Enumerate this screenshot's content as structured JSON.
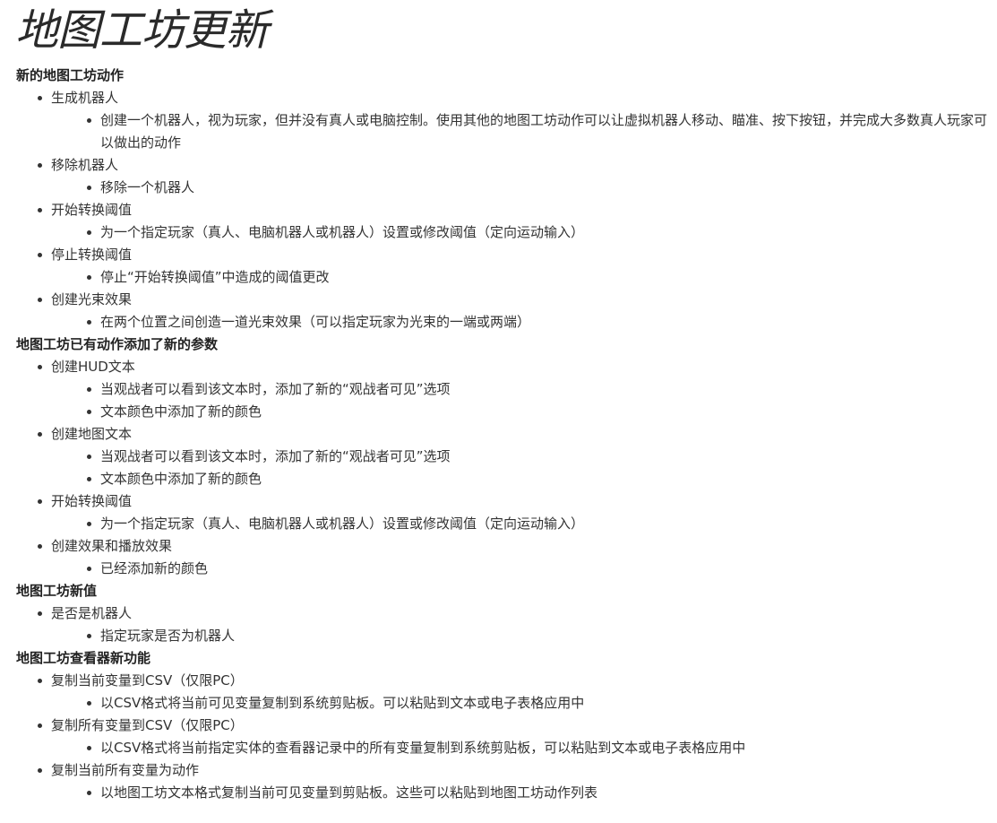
{
  "title": "地图工坊更新",
  "sections": [
    {
      "heading": "新的地图工坊动作",
      "items": [
        {
          "label": "生成机器人",
          "subitems": [
            "创建一个机器人，视为玩家，但并没有真人或电脑控制。使用其他的地图工坊动作可以让虚拟机器人移动、瞄准、按下按钮，并完成大多数真人玩家可以做出的动作"
          ]
        },
        {
          "label": "移除机器人",
          "subitems": [
            "移除一个机器人"
          ]
        },
        {
          "label": "开始转换阈值",
          "subitems": [
            "为一个指定玩家（真人、电脑机器人或机器人）设置或修改阈值（定向运动输入）"
          ]
        },
        {
          "label": "停止转换阈值",
          "subitems": [
            "停止“开始转换阈值”中造成的阈值更改"
          ]
        },
        {
          "label": "创建光束效果",
          "subitems": [
            "在两个位置之间创造一道光束效果（可以指定玩家为光束的一端或两端）"
          ]
        }
      ]
    },
    {
      "heading": "地图工坊已有动作添加了新的参数",
      "items": [
        {
          "label": "创建HUD文本",
          "subitems": [
            "当观战者可以看到该文本时，添加了新的“观战者可见”选项",
            "文本颜色中添加了新的颜色"
          ]
        },
        {
          "label": "创建地图文本",
          "subitems": [
            "当观战者可以看到该文本时，添加了新的“观战者可见”选项",
            "文本颜色中添加了新的颜色"
          ]
        },
        {
          "label": "开始转换阈值",
          "subitems": [
            "为一个指定玩家（真人、电脑机器人或机器人）设置或修改阈值（定向运动输入）"
          ]
        },
        {
          "label": "创建效果和播放效果",
          "subitems": [
            "已经添加新的颜色"
          ]
        }
      ]
    },
    {
      "heading": "地图工坊新值",
      "items": [
        {
          "label": "是否是机器人",
          "subitems": [
            "指定玩家是否为机器人"
          ]
        }
      ]
    },
    {
      "heading": "地图工坊查看器新功能",
      "items": [
        {
          "label": "复制当前变量到CSV（仅限PC）",
          "subitems": [
            "以CSV格式将当前可见变量复制到系统剪贴板。可以粘贴到文本或电子表格应用中"
          ]
        },
        {
          "label": "复制所有变量到CSV（仅限PC）",
          "subitems": [
            "以CSV格式将当前指定实体的查看器记录中的所有变量复制到系统剪贴板，可以粘贴到文本或电子表格应用中"
          ]
        },
        {
          "label": "复制当前所有变量为动作",
          "subitems": [
            "以地图工坊文本格式复制当前可见变量到剪贴板。这些可以粘贴到地图工坊动作列表"
          ]
        }
      ]
    }
  ]
}
